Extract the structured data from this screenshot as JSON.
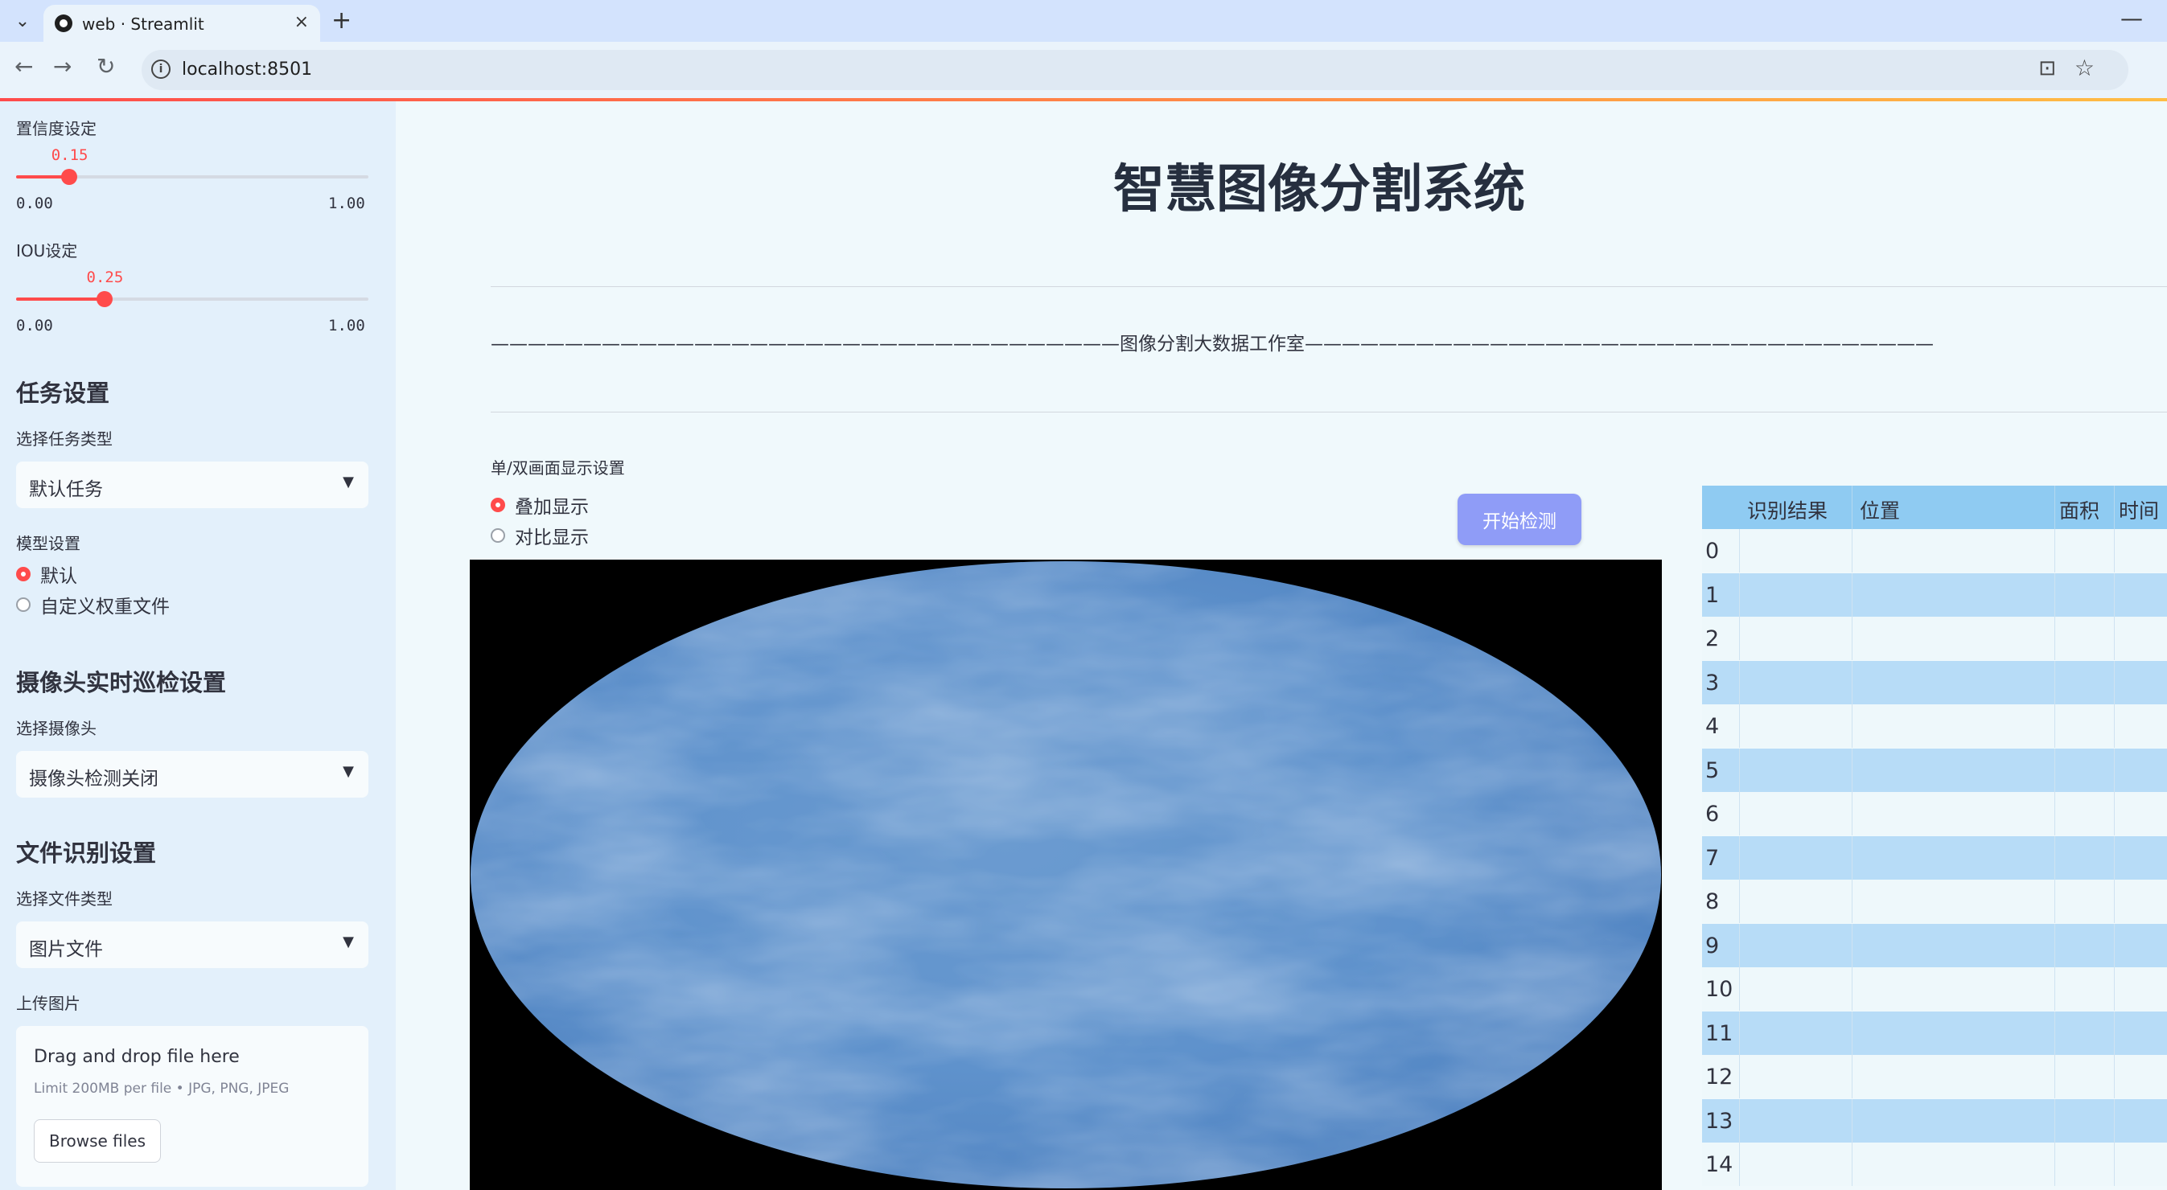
{
  "browser": {
    "tab_title": "web · Streamlit",
    "url": "localhost:8501",
    "close_glyph": "×",
    "new_tab_glyph": "+",
    "back_glyph": "←",
    "forward_glyph": "→",
    "reload_glyph": "↻",
    "tab_menu_glyph": "⌄",
    "minimize_glyph": "—",
    "info_glyph": "i",
    "translate_glyph": "⊡",
    "star_glyph": "☆"
  },
  "sidebar": {
    "confidence": {
      "label": "置信度设定",
      "value": "0.15",
      "min": "0.00",
      "max": "1.00",
      "fraction": 0.15
    },
    "iou": {
      "label": "IOU设定",
      "value": "0.25",
      "min": "0.00",
      "max": "1.00",
      "fraction": 0.25
    },
    "task_section": {
      "heading": "任务设置",
      "select_label": "选择任务类型",
      "select_value": "默认任务"
    },
    "model_section": {
      "label": "模型设置",
      "options": [
        {
          "label": "默认",
          "selected": true
        },
        {
          "label": "自定义权重文件",
          "selected": false
        }
      ]
    },
    "camera_section": {
      "heading": "摄像头实时巡检设置",
      "select_label": "选择摄像头",
      "select_value": "摄像头检测关闭"
    },
    "file_section": {
      "heading": "文件识别设置",
      "select_label": "选择文件类型",
      "select_value": "图片文件",
      "upload_label": "上传图片",
      "drop_text": "Drag and drop file here",
      "limit_text": "Limit 200MB per file • JPG, PNG, JPEG",
      "browse_label": "Browse files"
    },
    "chevron_glyph": "▼"
  },
  "main": {
    "title": "智慧图像分割系统",
    "subtitle": "——————————————————————————————————图像分割大数据工作室——————————————————————————————————",
    "display_label": "单/双画面显示设置",
    "display_options": [
      {
        "label": "叠加显示",
        "selected": true
      },
      {
        "label": "对比显示",
        "selected": false
      }
    ],
    "start_button": "开始检测"
  },
  "results_table": {
    "headers": [
      "识别结果",
      "位置",
      "面积",
      "时间"
    ],
    "row_indices": [
      "0",
      "1",
      "2",
      "3",
      "4",
      "5",
      "6",
      "7",
      "8",
      "9",
      "10",
      "11",
      "12",
      "13",
      "14"
    ]
  },
  "colors": {
    "accent": "#ff4b4b",
    "button": "#8f9cf7",
    "sidebar_bg": "#e3f0fb",
    "table_header": "#8fcbf2",
    "table_alt_row": "#b7dcf7"
  }
}
